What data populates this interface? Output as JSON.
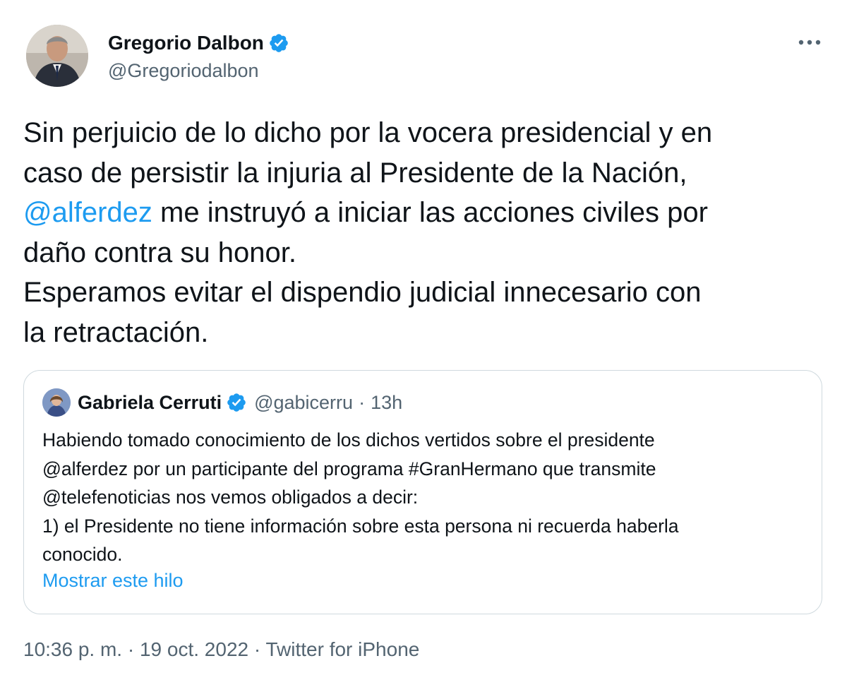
{
  "author": {
    "name": "Gregorio Dalbon",
    "handle": "@Gregoriodalbon"
  },
  "tweet": {
    "lines": [
      {
        "text": "Sin perjuicio de lo dicho por la vocera presidencial y en"
      },
      {
        "text": "caso de persistir la injuria al Presidente de la Nación,"
      },
      {
        "mention": "@alferdez",
        "text": " me instruyó a iniciar las acciones civiles por"
      },
      {
        "text": "daño contra su honor."
      },
      {
        "text": "Esperamos evitar el dispendio judicial innecesario con"
      },
      {
        "text": "la retractación."
      }
    ]
  },
  "quote": {
    "name": "Gabriela Cerruti",
    "handle": "@gabicerru",
    "separator": "·",
    "time": "13h",
    "lines": [
      "Habiendo tomado conocimiento de los dichos vertidos sobre el presidente",
      "@alferdez  por un participante del programa #GranHermano que transmite",
      "@telefenoticias nos vemos obligados a decir:",
      "1) el Presidente no tiene información sobre esta persona ni recuerda haberla",
      "conocido."
    ],
    "show_thread": "Mostrar este hilo"
  },
  "meta": {
    "text": "10:36 p. m. · 19 oct. 2022 · Twitter for iPhone"
  },
  "colors": {
    "accent": "#1d9bf0",
    "text": "#0f1419",
    "secondary": "#536471",
    "border": "#cfd9de"
  },
  "icons": {
    "verified": "verified-badge-icon",
    "more": "more-options-icon"
  }
}
